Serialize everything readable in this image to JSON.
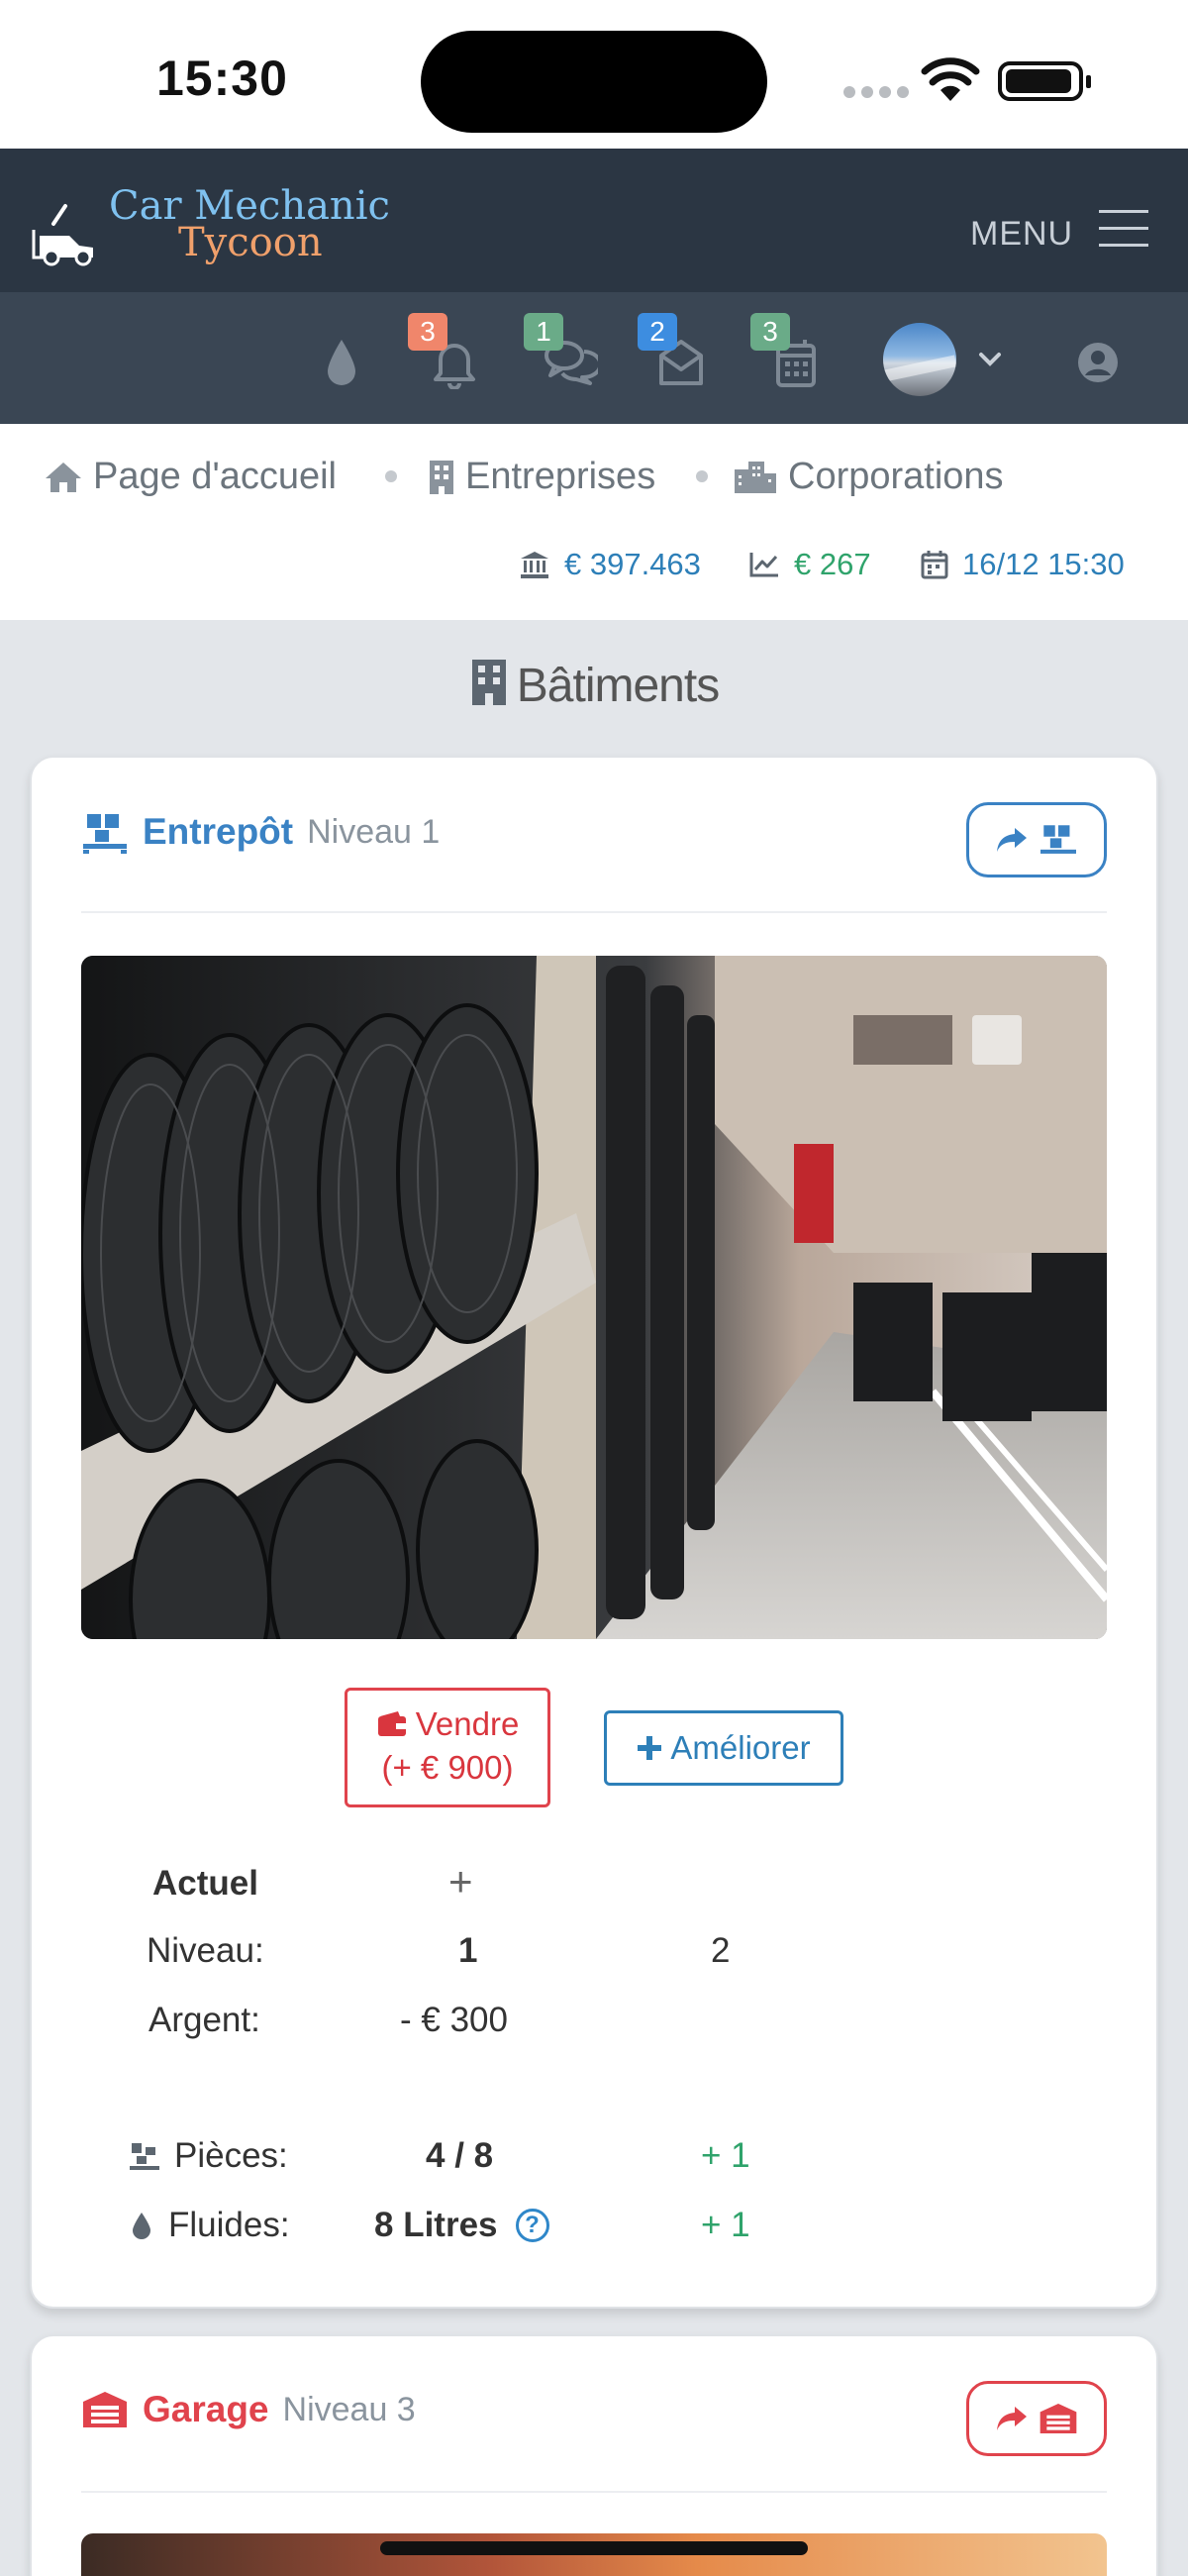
{
  "status_bar": {
    "time": "15:30"
  },
  "header": {
    "brand_line1": "Car Mechanic",
    "brand_line2": "Tycoon",
    "menu_label": "MENU"
  },
  "icon_bar": {
    "notifications_count": "3",
    "messages_count": "1",
    "mail_count": "2",
    "calendar_count": "3"
  },
  "breadcrumb": {
    "items": [
      "Page d'accueil",
      "Entreprises",
      "Corporations"
    ]
  },
  "stats": {
    "money": "€ 397.463",
    "income": "€ 267",
    "datetime": "16/12 15:30"
  },
  "section": {
    "title": "Bâtiments"
  },
  "warehouse": {
    "name": "Entrepôt",
    "level": "Niveau 1",
    "sell_label": "Vendre",
    "sell_value": "(+ € 900)",
    "upgrade_label": "Améliorer",
    "table": {
      "col_current": "Actuel",
      "col_plus": "+",
      "rows": [
        {
          "label": "Niveau:",
          "current": "1",
          "next": "2"
        },
        {
          "label": "Argent:",
          "current": "- € 300",
          "next": ""
        }
      ],
      "capacity": [
        {
          "label": "Pièces:",
          "current": "4 / 8",
          "next": "+ 1"
        },
        {
          "label": "Fluides:",
          "current": "8 Litres",
          "next": "+ 1"
        }
      ]
    }
  },
  "garage": {
    "name": "Garage",
    "level": "Niveau 3"
  },
  "colors": {
    "navbar": "#2b3643",
    "iconbar": "#3a4654",
    "warehouse_accent": "#3a82c4",
    "garage_accent": "#e0434c",
    "money_blue": "#2d7fb8",
    "income_green": "#2fa36b"
  }
}
